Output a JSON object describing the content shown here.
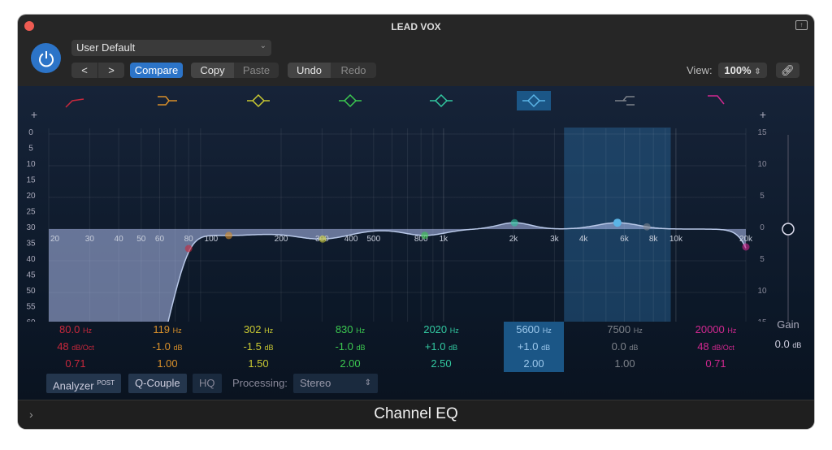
{
  "window": {
    "title": "LEAD VOX",
    "plugin_name": "Channel EQ"
  },
  "header": {
    "preset": "User Default",
    "prev": "<",
    "next": ">",
    "compare": "Compare",
    "copy": "Copy",
    "paste": "Paste",
    "undo": "Undo",
    "redo": "Redo",
    "view_label": "View:",
    "view_value": "100%"
  },
  "colors": {
    "accent": "#2c74c8",
    "selected_band": "#1b5686"
  },
  "graph": {
    "analyzer_scale": [
      "0",
      "5",
      "10",
      "15",
      "20",
      "25",
      "30",
      "35",
      "40",
      "45",
      "50",
      "55",
      "60"
    ],
    "gain_scale": [
      "15",
      "10",
      "5",
      "0",
      "5",
      "10",
      "15"
    ],
    "freq_labels": [
      {
        "f": 20,
        "t": "20"
      },
      {
        "f": 30,
        "t": "30"
      },
      {
        "f": 40,
        "t": "40"
      },
      {
        "f": 50,
        "t": "50"
      },
      {
        "f": 60,
        "t": "60"
      },
      {
        "f": 80,
        "t": "80"
      },
      {
        "f": 100,
        "t": "100"
      },
      {
        "f": 200,
        "t": "200"
      },
      {
        "f": 300,
        "t": "300"
      },
      {
        "f": 400,
        "t": "400"
      },
      {
        "f": 500,
        "t": "500"
      },
      {
        "f": 800,
        "t": "800"
      },
      {
        "f": 1000,
        "t": "1k"
      },
      {
        "f": 2000,
        "t": "2k"
      },
      {
        "f": 3000,
        "t": "3k"
      },
      {
        "f": 4000,
        "t": "4k"
      },
      {
        "f": 6000,
        "t": "6k"
      },
      {
        "f": 8000,
        "t": "8k"
      },
      {
        "f": 10000,
        "t": "10k"
      },
      {
        "f": 20000,
        "t": "20k"
      }
    ]
  },
  "bands": [
    {
      "type": "low-cut",
      "color": "#c8283c",
      "freq": "80.0",
      "gain": "48",
      "gain_unit": "dB/Oct",
      "q": "0.71",
      "f": 80,
      "g": 0,
      "qv": 0.71,
      "enabled": true
    },
    {
      "type": "low-shelf",
      "color": "#d9902a",
      "freq": "119",
      "gain": "-1.0",
      "gain_unit": "dB",
      "q": "1.00",
      "f": 119,
      "g": -1,
      "qv": 1
    },
    {
      "type": "bell",
      "color": "#c8c832",
      "freq": "302",
      "gain": "-1.5",
      "gain_unit": "dB",
      "q": "1.50",
      "f": 302,
      "g": -1.5,
      "qv": 1.5
    },
    {
      "type": "bell",
      "color": "#3cc850",
      "freq": "830",
      "gain": "-1.0",
      "gain_unit": "dB",
      "q": "2.00",
      "f": 830,
      "g": -1,
      "qv": 2
    },
    {
      "type": "bell",
      "color": "#32c8a0",
      "freq": "2020",
      "gain": "+1.0",
      "gain_unit": "dB",
      "q": "2.50",
      "f": 2020,
      "g": 1,
      "qv": 2.5
    },
    {
      "type": "bell",
      "color": "#5ab4e6",
      "freq": "5600",
      "gain": "+1.0",
      "gain_unit": "dB",
      "q": "2.00",
      "f": 5600,
      "g": 1,
      "qv": 2,
      "selected": true
    },
    {
      "type": "high-shelf",
      "color": "#7d828a",
      "freq": "7500",
      "gain": "0.0",
      "gain_unit": "dB",
      "q": "1.00",
      "f": 7500,
      "g": 0,
      "qv": 1
    },
    {
      "type": "high-cut",
      "color": "#d22890",
      "freq": "20000",
      "gain": "48",
      "gain_unit": "dB/Oct",
      "q": "0.71",
      "f": 20000,
      "g": 0,
      "qv": 0.71
    }
  ],
  "output": {
    "label": "Gain",
    "value": "0.0",
    "unit": "dB"
  },
  "footer": {
    "analyzer": "Analyzer",
    "analyzer_mode": "POST",
    "q_couple": "Q-Couple",
    "hq": "HQ",
    "processing_label": "Processing:",
    "processing_value": "Stereo"
  }
}
